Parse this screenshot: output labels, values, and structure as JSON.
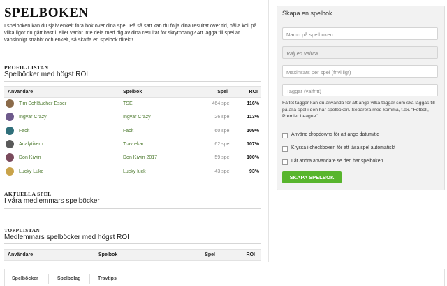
{
  "page": {
    "title": "SPELBOKEN",
    "intro": "I spelboken kan du själv enkelt föra bok över dina spel. På så sätt kan du följa dina resultat över tid, hålla koll på vilka ligor du gått bäst i, eller varför inte dela med dig av dina resultat för skrytpoäng? Att lägga till spel är vansinnigt snabbt och enkelt, så skaffa en spelbok direkt!"
  },
  "profile_list": {
    "kicker": "PROFIL-LISTAN",
    "title": "Spelböcker med högst ROI",
    "columns": {
      "user": "Användare",
      "book": "Spelbok",
      "bets": "Spel",
      "roi": "ROI"
    },
    "rows": [
      {
        "user": "Tim Schläucher Esser",
        "book": "TSE",
        "bets": "464 spel",
        "roi": "116%",
        "avatar_color": "#8b6b4a"
      },
      {
        "user": "Ingvar Crazy",
        "book": "Ingvar Crazy",
        "bets": "26 spel",
        "roi": "113%",
        "avatar_color": "#6e5a8c"
      },
      {
        "user": "Facit",
        "book": "Facit",
        "bets": "60 spel",
        "roi": "109%",
        "avatar_color": "#2f6f7a"
      },
      {
        "user": "Analytikern",
        "book": "Travrekar",
        "bets": "62 spel",
        "roi": "107%",
        "avatar_color": "#5a5a5a"
      },
      {
        "user": "Don Kiwin",
        "book": "Don Kiwin 2017",
        "bets": "59 spel",
        "roi": "100%",
        "avatar_color": "#7a4a5c"
      },
      {
        "user": "Lucky Luke",
        "book": "Lucky luck",
        "bets": "43 spel",
        "roi": "93%",
        "avatar_color": "#c9a34a"
      }
    ]
  },
  "current_bets": {
    "kicker": "AKTUELLA SPEL",
    "title": "I våra medlemmars spelböcker"
  },
  "top_list": {
    "kicker": "TOPPLISTAN",
    "title": "Medlemmars spelböcker med högst ROI",
    "columns": {
      "user": "Användare",
      "book": "Spelbok",
      "bets": "Spel",
      "roi": "ROI"
    }
  },
  "create_panel": {
    "title": "Skapa en spelbok",
    "name_placeholder": "Namn på spelboken",
    "currency_placeholder": "Välj en valuta",
    "max_stake_placeholder": "Maxinsats per spel (frivilligt)",
    "tags_placeholder": "Taggar (valfritt)",
    "hint": "Fältet taggar kan du använda för att ange vilka taggar som ska läggas till på alla spel i den här spelboken. Separera med komma, t.ex. \"Fotboll, Premier League\".",
    "checkboxes": [
      "Använd dropdowns för att ange datum/tid",
      "Kryssa i checkboxen för att låsa spel automatiskt",
      "Låt andra användare se den här spelboken"
    ],
    "submit_label": "SKAPA SPELBOK",
    "accent_color": "#58b52d"
  },
  "footer_tabs": [
    "Spelböcker",
    "Spelbolag",
    "Travtips"
  ]
}
